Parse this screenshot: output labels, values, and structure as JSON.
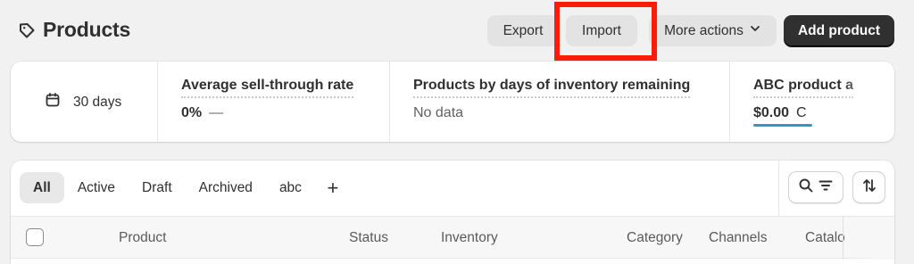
{
  "header": {
    "title": "Products",
    "export_label": "Export",
    "import_label": "Import",
    "more_actions_label": "More actions",
    "add_product_label": "Add product"
  },
  "analytics": {
    "period_label": "30 days",
    "metrics": [
      {
        "title": "Average sell-through rate",
        "value": "0%",
        "trend": "—"
      },
      {
        "title": "Products by days of inventory remaining",
        "value": "No data"
      },
      {
        "title": "ABC product a",
        "value": "$0.00",
        "suffix": "C"
      }
    ]
  },
  "products": {
    "tabs": [
      "All",
      "Active",
      "Draft",
      "Archived",
      "abc"
    ],
    "active_tab": "All",
    "add_tab_label": "+",
    "columns": [
      "Product",
      "Status",
      "Inventory",
      "Category",
      "Channels",
      "Catalo"
    ]
  },
  "colors": {
    "highlight_border": "#ff1a0a",
    "primary_button": "#303030",
    "accent_underline": "#2c9ac8",
    "page_background": "#f1f1f1"
  },
  "icons": {
    "title_icon": "tag-icon",
    "calendar": "calendar-icon",
    "more_actions": "chevron-down-icon",
    "search": "search-icon",
    "filter": "filter-icon",
    "sort": "sort-icon"
  }
}
